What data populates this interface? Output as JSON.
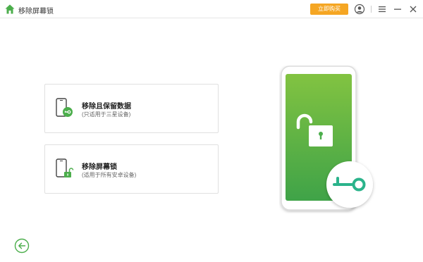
{
  "titlebar": {
    "title": "移除屏幕锁",
    "buy_label": "立即购买"
  },
  "options": [
    {
      "title": "移除且保留数据",
      "subtitle": "(只适用于三星设备)"
    },
    {
      "title": "移除屏幕锁",
      "subtitle": "(适用于所有安卓设备)"
    }
  ],
  "icons": {
    "home": "home-icon",
    "account": "account-icon",
    "menu": "menu-icon",
    "minimize": "minimize-icon",
    "close": "close-icon",
    "back": "back-arrow-icon"
  },
  "colors": {
    "accent_green": "#4cae4c",
    "buy_orange": "#f5a623",
    "phone_green_top": "#7dc242",
    "phone_green_bottom": "#3fa348",
    "key_teal": "#2bb38b"
  }
}
